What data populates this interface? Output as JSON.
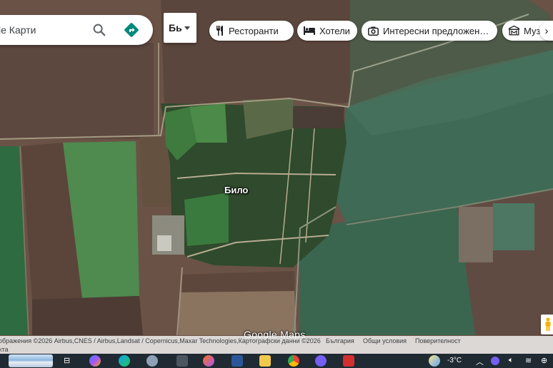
{
  "search": {
    "placeholder": "le Карти"
  },
  "language": {
    "label": "Бь"
  },
  "chips": [
    {
      "icon": "fork-knife-icon",
      "label": "Ресторанти"
    },
    {
      "icon": "bed-icon",
      "label": "Хотели"
    },
    {
      "icon": "camera-icon",
      "label": "Интересни предложен…"
    },
    {
      "icon": "museum-icon",
      "label": "Муз"
    }
  ],
  "map": {
    "place_label": "Било",
    "logo": "Google Maps"
  },
  "attribution": {
    "imagery": "ображения ©2026 Airbus,CNES / Airbus,Landsat / Copernicus,Maxar Technologies,Картографски данни ©2026",
    "line2": "укта",
    "country": "България",
    "terms": "Общи условия",
    "privacy": "Поверителност"
  },
  "taskbar": {
    "temperature": "-3°C",
    "icons": [
      "widgets-icon",
      "task-view-icon",
      "copilot-icon",
      "edge-icon",
      "paint-icon",
      "calculator-icon",
      "firefox-icon",
      "word-icon",
      "file-explorer-icon",
      "chrome-icon",
      "viber-icon",
      "acrobat-icon",
      "weather-icon",
      "chevron-up-icon",
      "viber-tray-icon",
      "speaker-icon",
      "wifi-icon",
      "globe-icon"
    ]
  },
  "colors": {
    "accent": "#1a73e8",
    "directions": "#00897b",
    "taskbar": "#1f2a33"
  }
}
